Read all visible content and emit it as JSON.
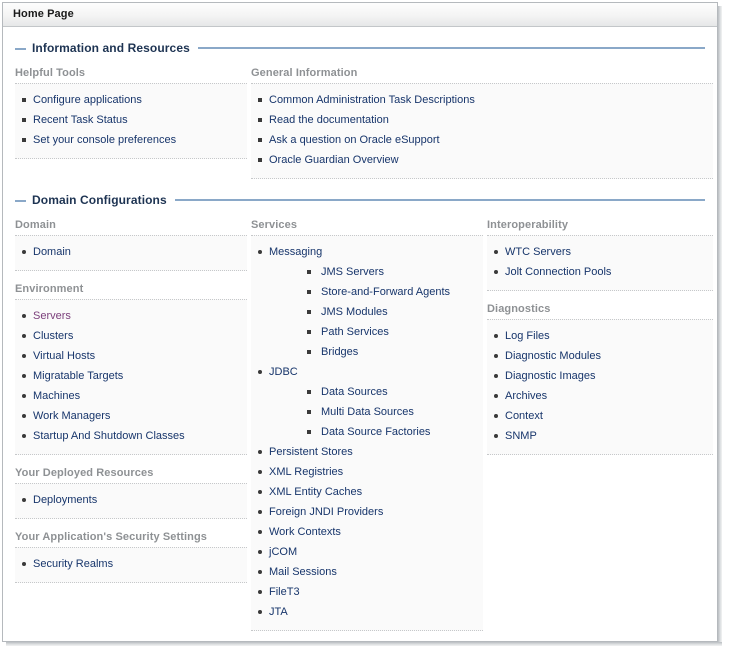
{
  "window": {
    "title": "Home Page"
  },
  "sections": [
    {
      "id": "information-and-resources",
      "title": "Information and Resources",
      "toggle_icon": "minus-icon",
      "groups": [
        {
          "id": "helpful-tools",
          "title": "Helpful Tools",
          "bullet": "square",
          "items": [
            {
              "label": "Configure applications",
              "visited": false
            },
            {
              "label": "Recent Task Status",
              "visited": false
            },
            {
              "label": "Set your console preferences",
              "visited": false
            }
          ]
        },
        {
          "id": "general-information",
          "title": "General Information",
          "bullet": "square",
          "items": [
            {
              "label": "Common Administration Task Descriptions",
              "visited": false
            },
            {
              "label": "Read the documentation",
              "visited": false
            },
            {
              "label": "Ask a question on Oracle eSupport",
              "visited": false
            },
            {
              "label": "Oracle Guardian Overview",
              "visited": false
            }
          ]
        }
      ]
    },
    {
      "id": "domain-configurations",
      "title": "Domain Configurations",
      "toggle_icon": "minus-icon",
      "groups": [
        {
          "id": "domain",
          "title": "Domain",
          "bullet": "round",
          "items": [
            {
              "label": "Domain",
              "visited": false
            }
          ]
        },
        {
          "id": "environment",
          "title": "Environment",
          "bullet": "round",
          "items": [
            {
              "label": "Servers",
              "visited": true
            },
            {
              "label": "Clusters",
              "visited": false
            },
            {
              "label": "Virtual Hosts",
              "visited": false
            },
            {
              "label": "Migratable Targets",
              "visited": false
            },
            {
              "label": "Machines",
              "visited": false
            },
            {
              "label": "Work Managers",
              "visited": false
            },
            {
              "label": "Startup And Shutdown Classes",
              "visited": false
            }
          ]
        },
        {
          "id": "your-deployed-resources",
          "title": "Your Deployed Resources",
          "bullet": "round",
          "items": [
            {
              "label": "Deployments",
              "visited": false
            }
          ]
        },
        {
          "id": "your-applications-security-settings",
          "title": "Your Application's Security Settings",
          "bullet": "round",
          "items": [
            {
              "label": "Security Realms",
              "visited": false
            }
          ]
        },
        {
          "id": "services",
          "title": "Services",
          "bullet": "round",
          "items": [
            {
              "label": "Messaging",
              "visited": false,
              "children": [
                {
                  "label": "JMS Servers",
                  "visited": false
                },
                {
                  "label": "Store-and-Forward Agents",
                  "visited": false
                },
                {
                  "label": "JMS Modules",
                  "visited": false
                },
                {
                  "label": "Path Services",
                  "visited": false
                },
                {
                  "label": "Bridges",
                  "visited": false
                }
              ]
            },
            {
              "label": "JDBC",
              "visited": false,
              "children": [
                {
                  "label": "Data Sources",
                  "visited": false
                },
                {
                  "label": "Multi Data Sources",
                  "visited": false
                },
                {
                  "label": "Data Source Factories",
                  "visited": false
                }
              ]
            },
            {
              "label": "Persistent Stores",
              "visited": false
            },
            {
              "label": "XML Registries",
              "visited": false
            },
            {
              "label": "XML Entity Caches",
              "visited": false
            },
            {
              "label": "Foreign JNDI Providers",
              "visited": false
            },
            {
              "label": "Work Contexts",
              "visited": false
            },
            {
              "label": "jCOM",
              "visited": false
            },
            {
              "label": "Mail Sessions",
              "visited": false
            },
            {
              "label": "FileT3",
              "visited": false
            },
            {
              "label": "JTA",
              "visited": false
            }
          ]
        },
        {
          "id": "interoperability",
          "title": "Interoperability",
          "bullet": "round",
          "items": [
            {
              "label": "WTC Servers",
              "visited": false
            },
            {
              "label": "Jolt Connection Pools",
              "visited": false
            }
          ]
        },
        {
          "id": "diagnostics",
          "title": "Diagnostics",
          "bullet": "round",
          "items": [
            {
              "label": "Log Files",
              "visited": false
            },
            {
              "label": "Diagnostic Modules",
              "visited": false
            },
            {
              "label": "Diagnostic Images",
              "visited": false
            },
            {
              "label": "Archives",
              "visited": false
            },
            {
              "label": "Context",
              "visited": false
            },
            {
              "label": "SNMP",
              "visited": false
            }
          ]
        }
      ]
    }
  ],
  "colors": {
    "link": "#17356b",
    "link_visited": "#7b3f7b",
    "section_title": "#1d3352",
    "section_rule": "#8aa8c8",
    "group_title": "#8e9194",
    "panel_bg": "#fafafa"
  }
}
